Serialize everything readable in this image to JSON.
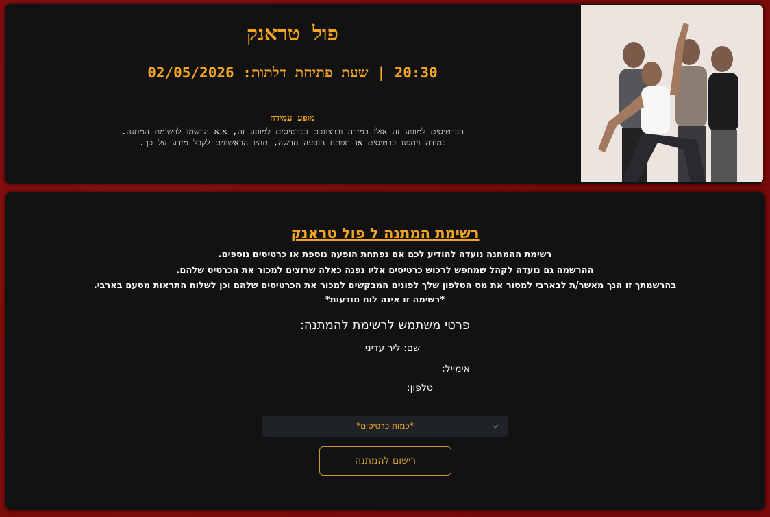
{
  "event": {
    "artist": "פול טראנק",
    "date_line": "20:30 | שעת פתיחת דלתות: 02/05/2026",
    "show_type": "מופע עמידה",
    "description_line1": "הכרטיסים למופע זה אזלו במידה וברצונכם בכרטיסים למופע זה, אנא הרשמו לרשימת המתנה.",
    "description_line2": "במידה ויתפנו כרטיסים או תפתח הופעה חדשה, תהיו הראשונים לקבל מידע על כך."
  },
  "waitlist": {
    "title": "רשימת המתנה ל פול טראנק",
    "lines": [
      "רשימת ההמתנה נועדה להודיע לכם אם נפתחת הופעה נוספת או כרטיסים נוספים.",
      "ההרשמה גם נועדה לקהל שמחפש לרכוש כרטיסים אליו נפנה כאלה שרוצים למכור את הכרטיס שלהם.",
      "בהרשמתך זו הנך מאשר/ת לבארבי למסור את מס הטלפון שלך לפונים המבקשים למכור את הכרטיסים שלהם וכן לשלוח התראות מטעם בארבי.",
      "*רשימה זו אינה לוח מודעות*"
    ],
    "user_details_title": "פרטי משתמש לרשימת להמתנה:",
    "name_label": "שם:",
    "name_value": "ליר עדיני",
    "email_label": "אימייל:",
    "email_value": "",
    "phone_label": "טלפון:",
    "phone_value": "",
    "ticket_select_placeholder": "*כמות כרטיסים*",
    "register_button": "רישום להמתנה"
  },
  "colors": {
    "accent": "#f5a524",
    "card_bg": "#121212",
    "page_bg": "#7a0b0b"
  },
  "icons": {
    "dropdown": "chevron-down-icon"
  }
}
